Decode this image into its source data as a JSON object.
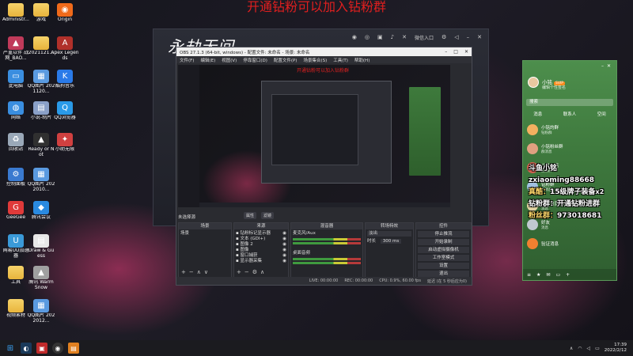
{
  "banner": "开通钻粉可以加入钻粉群",
  "desktop_icons": [
    {
      "label": "Administr...",
      "icon": "folder-icon",
      "color": "#e9b94a"
    },
    {
      "label": "游戏",
      "icon": "folder-icon",
      "color": "#e9b94a"
    },
    {
      "label": "Origin",
      "icon": "origin-icon",
      "color": "#f06a1a"
    },
    {
      "label": "严重以伴 战网_BAO...",
      "icon": "game-icon",
      "color": "#c03a5a"
    },
    {
      "label": "2021121...",
      "icon": "folder-icon",
      "color": "#e9b94a"
    },
    {
      "label": "Apex Legends",
      "icon": "apex-icon",
      "color": "#b0302a"
    },
    {
      "label": "此电脑",
      "icon": "computer-icon",
      "color": "#3a8ee0"
    },
    {
      "label": "QQ图片 2021120...",
      "icon": "image-icon",
      "color": "#5a9ae0"
    },
    {
      "label": "酷狗音乐",
      "icon": "kugou-icon",
      "color": "#2a7ae8"
    },
    {
      "label": "网络",
      "icon": "network-icon",
      "color": "#3a8ee0"
    },
    {
      "label": "小说-制片",
      "icon": "file-icon",
      "color": "#8aa0c8"
    },
    {
      "label": "QQ浏览器",
      "icon": "qqbrowser-icon",
      "color": "#2a9ae8"
    },
    {
      "label": "回收站",
      "icon": "recycle-bin-icon",
      "color": "#9aa8b8"
    },
    {
      "label": "Ready or Not",
      "icon": "game-icon",
      "color": "#303030"
    },
    {
      "label": "小助无限",
      "icon": "app-icon",
      "color": "#d04040"
    },
    {
      "label": "控制面板",
      "icon": "control-panel-icon",
      "color": "#3a7ad0"
    },
    {
      "label": "QQ图片 2022010...",
      "icon": "image-icon",
      "color": "#5a9ae0"
    },
    {
      "label": "GeeGee",
      "icon": "geegee-icon",
      "color": "#e03a3a"
    },
    {
      "label": "腾讯会议",
      "icon": "meeting-icon",
      "color": "#2a8ae0"
    },
    {
      "label": "网易UU加速器",
      "icon": "uu-icon",
      "color": "#3a9ad8"
    },
    {
      "label": "Draw & Guess",
      "icon": "file-icon",
      "color": "#e8e8e8"
    },
    {
      "label": "工具",
      "icon": "folder-icon",
      "color": "#e9b94a"
    },
    {
      "label": "腾讯 Warm Snow",
      "icon": "game-icon",
      "color": "#a0a0a0"
    },
    {
      "label": "视频素材",
      "icon": "folder-icon",
      "color": "#e9b94a"
    },
    {
      "label": "QQ图片 2022012...",
      "icon": "image-icon",
      "color": "#5a9ae0"
    }
  ],
  "bg_app": {
    "logo": "永劫无间",
    "login": "微信入口"
  },
  "obs": {
    "title": "OBS 27.1.3 (64-bit, windows) - 配置文件: 未命名 - 场景: 未命名",
    "menu": [
      "文件(F)",
      "编辑(E)",
      "视图(V)",
      "停靠窗口(D)",
      "配置文件(P)",
      "场景集合(S)",
      "工具(T)",
      "帮助(H)"
    ],
    "preview_banner": "开通钻粉可以加入钻粉群",
    "source_label": "未选择源",
    "ctrl_buttons": [
      "属性",
      "滤镜"
    ],
    "docks": {
      "scenes": {
        "header": "场景",
        "items": [
          "场景"
        ]
      },
      "sources": {
        "header": "来源",
        "items": [
          "钻粉标记显示器",
          "文本 (GDI+)",
          "图像 2",
          "图像",
          "窗口捕获",
          "显示器采集"
        ]
      },
      "mixer": {
        "header": "混音器",
        "items": [
          "麦克风/Aux",
          "桌面音频"
        ]
      },
      "transitions": {
        "header": "转场特效",
        "type": "淡出",
        "duration_label": "时长",
        "duration": "300 ms"
      },
      "controls": {
        "header": "控件",
        "buttons": [
          "停止推流",
          "开始录制",
          "启动虚拟摄像机",
          "工作室模式",
          "设置",
          "退出"
        ]
      }
    },
    "status": [
      "LIVE: 00:00:00",
      "REC: 00:00:00",
      "CPU: 0.9%, 60.00 fps",
      "延迟 (在 5 秒后应为0)"
    ]
  },
  "qq": {
    "name": "小铭",
    "vip": "SVIP",
    "signature": "编辑个性签名",
    "search_placeholder": "搜索",
    "tabs": [
      "消息",
      "联系人",
      "空间"
    ],
    "contacts": [
      {
        "title": "小铭的群",
        "sub": "钻粉群",
        "color": "#f3b060"
      },
      {
        "title": "小铭粉丝群",
        "sub": "群消息",
        "color": "#e0a080"
      },
      {
        "title": "斗鱼小铭",
        "sub": "直播群",
        "color": "#d06050"
      },
      {
        "title": "钻粉群",
        "sub": "群消息",
        "color": "#a0c0e0"
      },
      {
        "title": "小铭的直播间",
        "sub": "消息",
        "color": "#e0d0a0"
      },
      {
        "title": "好友",
        "sub": "消息",
        "color": "#c0c8d0"
      },
      {
        "title": "验证消息",
        "sub": "",
        "color": "#f08030"
      }
    ],
    "bottom_icons": [
      "menu-icon",
      "qzone-icon",
      "mail-icon",
      "folder-icon",
      "add-icon"
    ]
  },
  "danmaku": [
    {
      "user": "",
      "message": "斗鱼小铭",
      "extra": ""
    },
    {
      "user": "",
      "message": "zxiaoming88668",
      "extra": ""
    },
    {
      "user": "真酷：",
      "message": "15级牌子装备",
      "extra": "x2"
    },
    {
      "user": "",
      "message": "钻粉群：开通钻粉进群",
      "extra": ""
    },
    {
      "user": "粉丝群：",
      "message": "973018681",
      "extra": ""
    }
  ],
  "taskbar": {
    "apps": [
      "windows-start-icon",
      "steam-icon",
      "red-app-icon",
      "obs-icon",
      "orange-app-icon"
    ],
    "time": "17:39",
    "date": "2022/2/12"
  }
}
